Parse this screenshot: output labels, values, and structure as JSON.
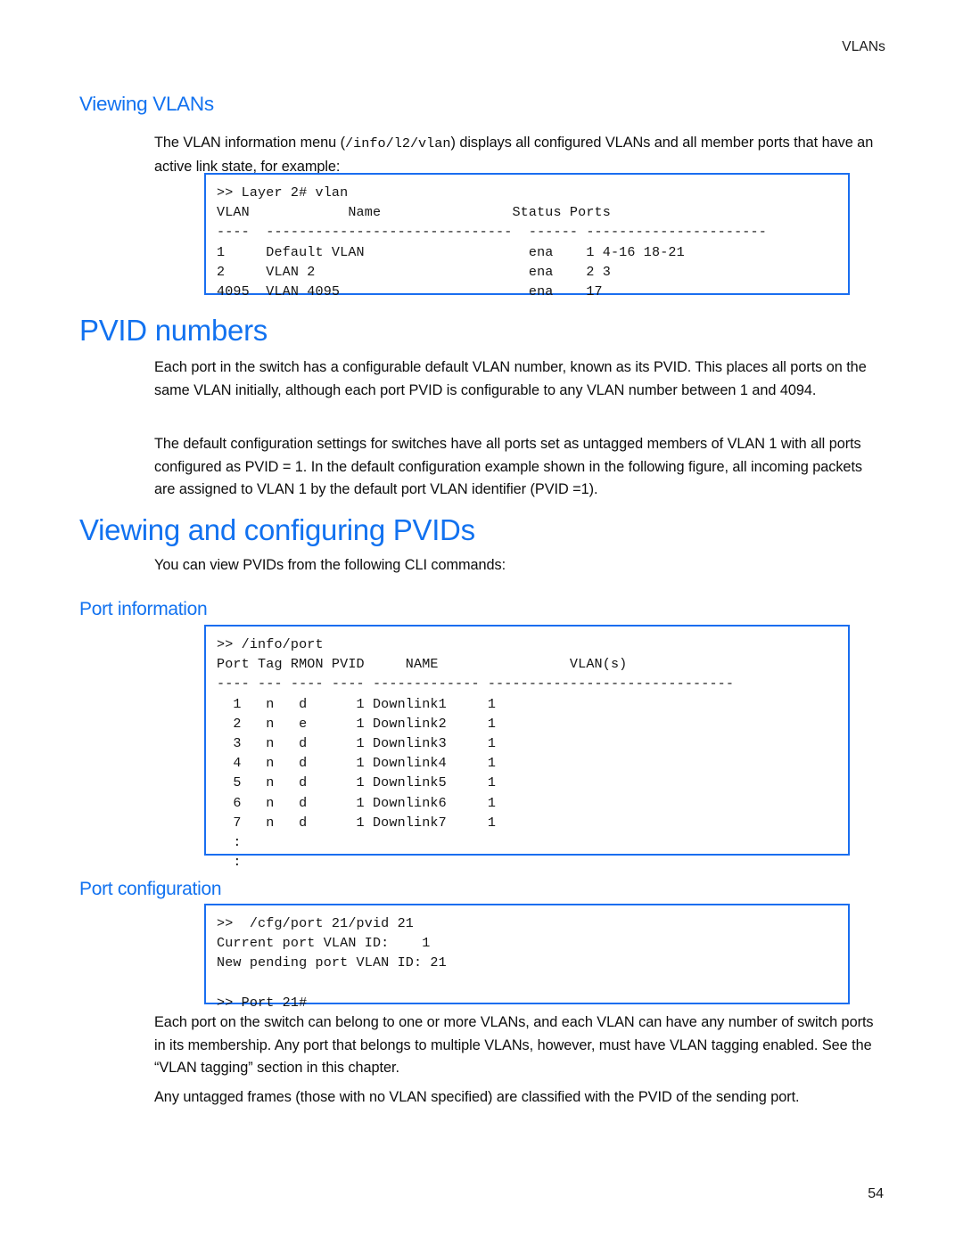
{
  "document": {
    "running_header": "VLANs",
    "page_number": "54"
  },
  "sections": {
    "viewing_vlans": {
      "heading": "Viewing VLANs",
      "intro_part1": "The VLAN information menu (",
      "intro_command": "/info/l2/vlan",
      "intro_part2": ") displays all configured VLANs and all member ports that have an active link state, for example:",
      "code": ">> Layer 2# vlan\nVLAN            Name                Status Ports\n----  ------------------------------  ------ ----------------------\n1     Default VLAN                    ena    1 4-16 18-21\n2     VLAN 2                          ena    2 3\n4095  VLAN 4095                       ena    17"
    },
    "pvid_numbers": {
      "heading": "PVID numbers",
      "paragraph1": "Each port in the switch has a configurable default VLAN number, known as its PVID. This places all ports on the same VLAN initially, although each port PVID is configurable to any VLAN number between 1 and 4094.",
      "paragraph2": "The default configuration settings for switches have all ports set as untagged members of VLAN 1 with all ports configured as PVID = 1. In the default configuration example shown in the following figure, all incoming packets are assigned to VLAN 1 by the default port VLAN identifier (PVID =1)."
    },
    "viewing_configuring_pvids": {
      "heading": "Viewing and configuring PVIDs",
      "intro": "You can view PVIDs from the following CLI commands:",
      "port_information": {
        "heading": "Port information",
        "code": ">> /info/port\nPort Tag RMON PVID     NAME                VLAN(s)\n---- --- ---- ---- ------------- ------------------------------\n  1   n   d      1 Downlink1     1\n  2   n   e      1 Downlink2     1\n  3   n   d      1 Downlink3     1\n  4   n   d      1 Downlink4     1\n  5   n   d      1 Downlink5     1\n  6   n   d      1 Downlink6     1\n  7   n   d      1 Downlink7     1\n  :\n  :"
      },
      "port_configuration": {
        "heading": "Port configuration",
        "code": ">>  /cfg/port 21/pvid 21\nCurrent port VLAN ID:    1\nNew pending port VLAN ID: 21\n\n>> Port 21#"
      }
    },
    "closing": {
      "paragraph1": "Each port on the switch can belong to one or more VLANs, and each VLAN can have any number of switch ports in its membership. Any port that belongs to multiple VLANs, however, must have VLAN tagging enabled. See the “VLAN tagging” section in this chapter.",
      "paragraph2": "Any untagged frames (those with no VLAN specified) are classified with the PVID of the sending port."
    }
  }
}
